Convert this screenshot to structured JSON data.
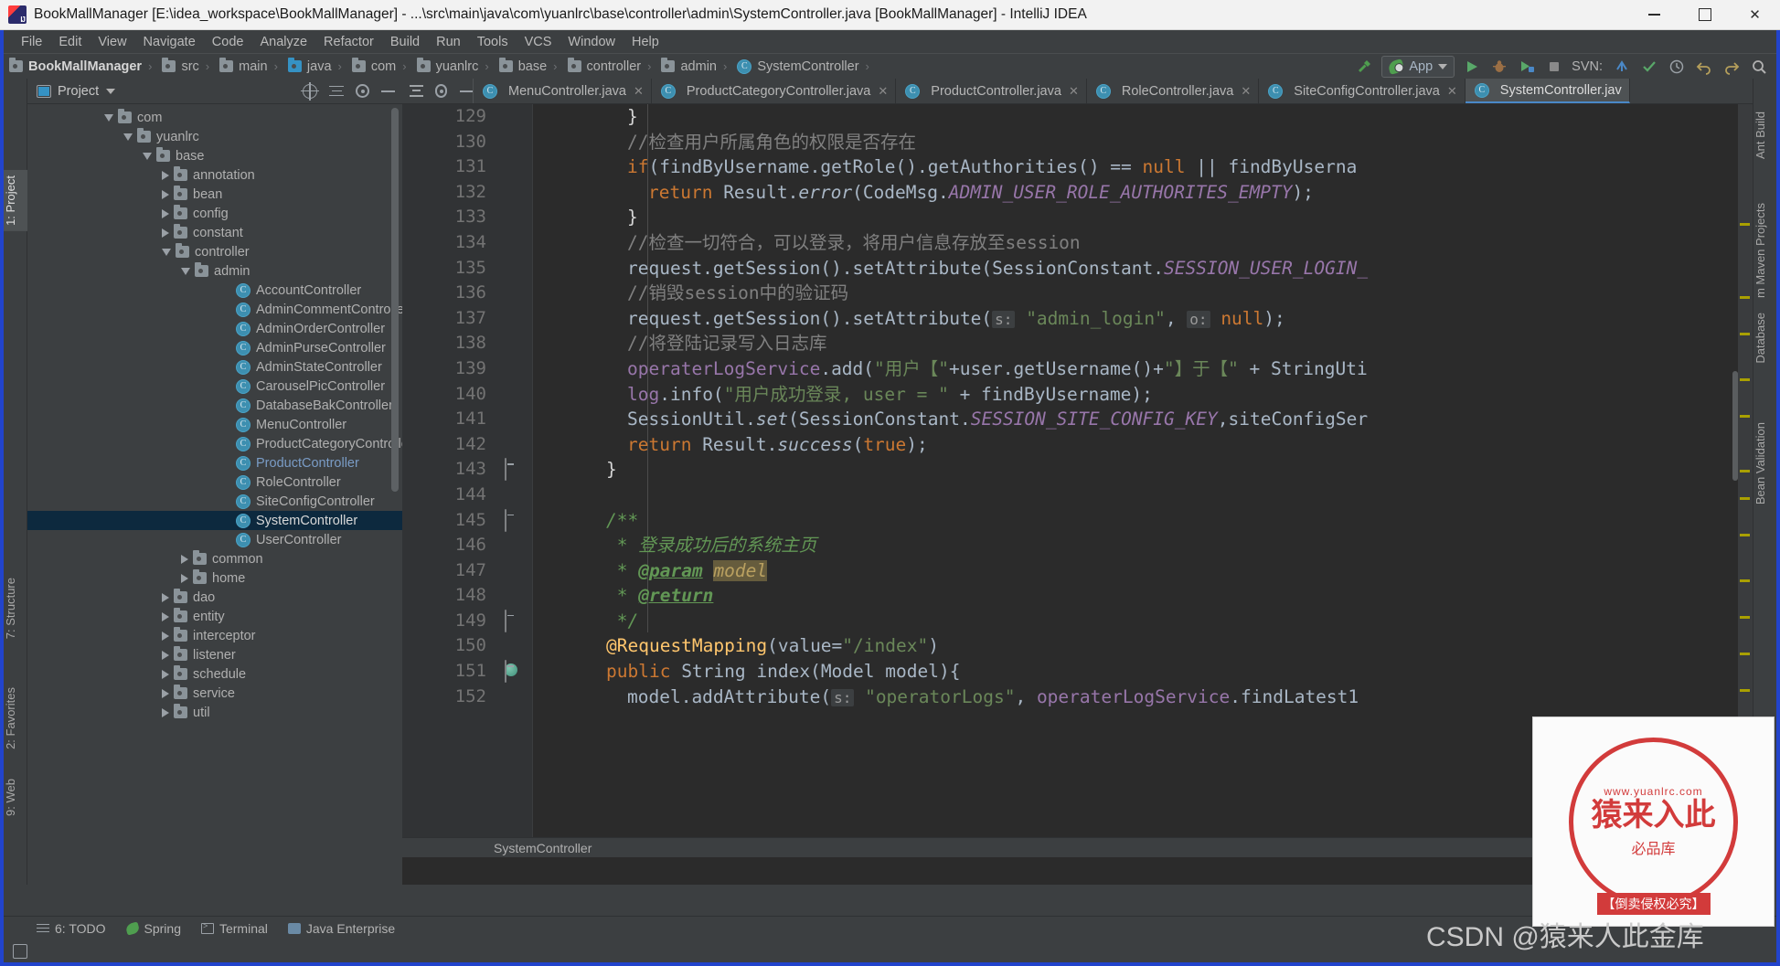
{
  "window": {
    "title": "BookMallManager [E:\\idea_workspace\\BookMallManager] - ...\\src\\main\\java\\com\\yuanlrc\\base\\controller\\admin\\SystemController.java [BookMallManager] - IntelliJ IDEA",
    "minimize_label": "",
    "maximize_label": "",
    "close_label": "✕",
    "app_icon": "intellij-idea-icon"
  },
  "menubar": {
    "items": [
      "File",
      "Edit",
      "View",
      "Navigate",
      "Code",
      "Analyze",
      "Refactor",
      "Build",
      "Run",
      "Tools",
      "VCS",
      "Window",
      "Help"
    ]
  },
  "breadcrumb": {
    "items": [
      {
        "label": "BookMallManager",
        "icon": "folder-icon",
        "kind": "project"
      },
      {
        "label": "src",
        "icon": "folder-icon",
        "kind": "folder"
      },
      {
        "label": "main",
        "icon": "folder-icon",
        "kind": "folder"
      },
      {
        "label": "java",
        "icon": "folder-icon",
        "kind": "source-folder"
      },
      {
        "label": "com",
        "icon": "folder-icon",
        "kind": "package"
      },
      {
        "label": "yuanlrc",
        "icon": "folder-icon",
        "kind": "package"
      },
      {
        "label": "base",
        "icon": "folder-icon",
        "kind": "package"
      },
      {
        "label": "controller",
        "icon": "folder-icon",
        "kind": "package"
      },
      {
        "label": "admin",
        "icon": "folder-icon",
        "kind": "package"
      },
      {
        "label": "SystemController",
        "icon": "class-icon",
        "kind": "class"
      }
    ],
    "separator": "›"
  },
  "toolbar": {
    "build_icon": "hammer-icon",
    "run_config": "App",
    "run_icon": "run-icon",
    "debug_icon": "debug-icon",
    "coverage_icon": "run-coverage-icon",
    "stop_icon": "stop-icon",
    "svn_label": "SVN:",
    "svn_update_icon": "svn-update-icon",
    "svn_commit_icon": "svn-commit-icon",
    "svn_history_icon": "svn-history-icon",
    "undo_icon": "undo-icon",
    "redo_icon": "redo-icon",
    "search_icon": "search-icon"
  },
  "left_strip": {
    "tabs": [
      {
        "label": "1: Project",
        "selected": true
      },
      {
        "label": "7: Structure",
        "selected": false
      },
      {
        "label": "2: Favorites",
        "selected": false
      },
      {
        "label": "9: Web",
        "selected": false
      }
    ]
  },
  "right_strip": {
    "tabs": [
      {
        "label": "Ant Build"
      },
      {
        "label": "m Maven Projects"
      },
      {
        "label": "Database"
      },
      {
        "label": "Bean Validation"
      }
    ]
  },
  "project_panel": {
    "title": "Project",
    "title_caret": "chevron-down-icon",
    "tools": [
      "locate-icon",
      "collapse-all-icon",
      "settings-gear-icon",
      "hide-icon"
    ],
    "tree": [
      {
        "label": "com",
        "indent": 4,
        "state": "open",
        "icon": "folder-icon",
        "selected": false
      },
      {
        "label": "yuanlrc",
        "indent": 5,
        "state": "open",
        "icon": "folder-icon",
        "selected": false
      },
      {
        "label": "base",
        "indent": 6,
        "state": "open",
        "icon": "folder-icon",
        "selected": false
      },
      {
        "label": "annotation",
        "indent": 7,
        "state": "closed",
        "icon": "folder-icon",
        "selected": false
      },
      {
        "label": "bean",
        "indent": 7,
        "state": "closed",
        "icon": "folder-icon",
        "selected": false
      },
      {
        "label": "config",
        "indent": 7,
        "state": "closed",
        "icon": "folder-icon",
        "selected": false
      },
      {
        "label": "constant",
        "indent": 7,
        "state": "closed",
        "icon": "folder-icon",
        "selected": false
      },
      {
        "label": "controller",
        "indent": 7,
        "state": "open",
        "icon": "folder-icon",
        "selected": false
      },
      {
        "label": "admin",
        "indent": 8,
        "state": "open",
        "icon": "folder-icon",
        "selected": false
      },
      {
        "label": "AccountController",
        "indent": 10,
        "state": "leaf",
        "icon": "class-icon",
        "selected": false
      },
      {
        "label": "AdminCommentController",
        "indent": 10,
        "state": "leaf",
        "icon": "class-icon",
        "selected": false
      },
      {
        "label": "AdminOrderController",
        "indent": 10,
        "state": "leaf",
        "icon": "class-icon",
        "selected": false
      },
      {
        "label": "AdminPurseController",
        "indent": 10,
        "state": "leaf",
        "icon": "class-icon",
        "selected": false
      },
      {
        "label": "AdminStateController",
        "indent": 10,
        "state": "leaf",
        "icon": "class-icon",
        "selected": false
      },
      {
        "label": "CarouselPicController",
        "indent": 10,
        "state": "leaf",
        "icon": "class-icon",
        "selected": false
      },
      {
        "label": "DatabaseBakController",
        "indent": 10,
        "state": "leaf",
        "icon": "class-icon",
        "selected": false
      },
      {
        "label": "MenuController",
        "indent": 10,
        "state": "leaf",
        "icon": "class-icon",
        "selected": false
      },
      {
        "label": "ProductCategoryController",
        "indent": 10,
        "state": "leaf",
        "icon": "class-icon",
        "selected": false
      },
      {
        "label": "ProductController",
        "indent": 10,
        "state": "leaf",
        "icon": "class-icon",
        "selected": false,
        "highlight": true
      },
      {
        "label": "RoleController",
        "indent": 10,
        "state": "leaf",
        "icon": "class-icon",
        "selected": false
      },
      {
        "label": "SiteConfigController",
        "indent": 10,
        "state": "leaf",
        "icon": "class-icon",
        "selected": false
      },
      {
        "label": "SystemController",
        "indent": 10,
        "state": "leaf",
        "icon": "class-icon",
        "selected": true
      },
      {
        "label": "UserController",
        "indent": 10,
        "state": "leaf",
        "icon": "class-icon",
        "selected": false
      },
      {
        "label": "common",
        "indent": 8,
        "state": "closed",
        "icon": "folder-icon",
        "selected": false
      },
      {
        "label": "home",
        "indent": 8,
        "state": "closed",
        "icon": "folder-icon",
        "selected": false
      },
      {
        "label": "dao",
        "indent": 7,
        "state": "closed",
        "icon": "folder-icon",
        "selected": false
      },
      {
        "label": "entity",
        "indent": 7,
        "state": "closed",
        "icon": "folder-icon",
        "selected": false
      },
      {
        "label": "interceptor",
        "indent": 7,
        "state": "closed",
        "icon": "folder-icon",
        "selected": false
      },
      {
        "label": "listener",
        "indent": 7,
        "state": "closed",
        "icon": "folder-icon",
        "selected": false
      },
      {
        "label": "schedule",
        "indent": 7,
        "state": "closed",
        "icon": "folder-icon",
        "selected": false
      },
      {
        "label": "service",
        "indent": 7,
        "state": "closed",
        "icon": "folder-icon",
        "selected": false
      },
      {
        "label": "util",
        "indent": 7,
        "state": "closed",
        "icon": "folder-icon",
        "selected": false
      }
    ]
  },
  "editor": {
    "tabs": [
      {
        "label": "MenuController.java",
        "active": false,
        "close": "✕"
      },
      {
        "label": "ProductCategoryController.java",
        "active": false,
        "close": "✕"
      },
      {
        "label": "ProductController.java",
        "active": false,
        "close": "✕"
      },
      {
        "label": "RoleController.java",
        "active": false,
        "close": "✕"
      },
      {
        "label": "SiteConfigController.java",
        "active": false,
        "close": "✕"
      },
      {
        "label": "SystemController.jav",
        "active": true,
        "close": ""
      }
    ],
    "status_breadcrumb": "SystemController",
    "first_line_number": 129,
    "lines": [
      {
        "n": 129,
        "indent": 2,
        "tokens": [
          {
            "t": "}",
            "c": "white"
          }
        ]
      },
      {
        "n": 130,
        "indent": 2,
        "tokens": [
          {
            "t": "//检查用户所属角色的权限是否存在",
            "c": "cmt"
          }
        ]
      },
      {
        "n": 131,
        "indent": 2,
        "tokens": [
          {
            "t": "if",
            "c": "kw"
          },
          {
            "t": "(findByUsername.getRole().getAuthorities() == ",
            "c": "plain"
          },
          {
            "t": "null",
            "c": "kw"
          },
          {
            "t": " || findByUserna",
            "c": "plain"
          }
        ]
      },
      {
        "n": 132,
        "indent": 3,
        "tokens": [
          {
            "t": "return",
            "c": "kw"
          },
          {
            "t": " Result.",
            "c": "plain"
          },
          {
            "t": "error",
            "c": "ital"
          },
          {
            "t": "(CodeMsg.",
            "c": "plain"
          },
          {
            "t": "ADMIN_USER_ROLE_AUTHORITES_EMPTY",
            "c": "cst"
          },
          {
            "t": ");",
            "c": "plain"
          }
        ]
      },
      {
        "n": 133,
        "indent": 2,
        "tokens": [
          {
            "t": "}",
            "c": "white"
          }
        ]
      },
      {
        "n": 134,
        "indent": 2,
        "tokens": [
          {
            "t": "//检查一切符合，可以登录，将用户信息存放至session",
            "c": "cmt"
          }
        ]
      },
      {
        "n": 135,
        "indent": 2,
        "tokens": [
          {
            "t": "request.getSession().setAttribute(SessionConstant.",
            "c": "plain"
          },
          {
            "t": "SESSION_USER_LOGIN_",
            "c": "cst"
          }
        ]
      },
      {
        "n": 136,
        "indent": 2,
        "tokens": [
          {
            "t": "//销毁session中的验证码",
            "c": "cmt"
          }
        ]
      },
      {
        "n": 137,
        "indent": 2,
        "tokens": [
          {
            "t": "request.getSession().setAttribute(",
            "c": "plain"
          },
          {
            "t": "s:",
            "c": "hint"
          },
          {
            "t": " ",
            "c": "plain"
          },
          {
            "t": "\"admin_login\"",
            "c": "str"
          },
          {
            "t": ", ",
            "c": "plain"
          },
          {
            "t": "o:",
            "c": "hint"
          },
          {
            "t": " ",
            "c": "plain"
          },
          {
            "t": "null",
            "c": "kw"
          },
          {
            "t": ");",
            "c": "plain"
          }
        ]
      },
      {
        "n": 138,
        "indent": 2,
        "tokens": [
          {
            "t": "//将登陆记录写入日志库",
            "c": "cmt"
          }
        ]
      },
      {
        "n": 139,
        "indent": 2,
        "tokens": [
          {
            "t": "operaterLogService",
            "c": "fld"
          },
          {
            "t": ".add(",
            "c": "plain"
          },
          {
            "t": "\"用户【\"",
            "c": "str"
          },
          {
            "t": "+user.getUsername()+",
            "c": "plain"
          },
          {
            "t": "\"】于【\"",
            "c": "str"
          },
          {
            "t": " + StringUti",
            "c": "plain"
          }
        ]
      },
      {
        "n": 140,
        "indent": 2,
        "tokens": [
          {
            "t": "log",
            "c": "fld"
          },
          {
            "t": ".info(",
            "c": "plain"
          },
          {
            "t": "\"用户成功登录, user = \"",
            "c": "str"
          },
          {
            "t": " + findByUsername);",
            "c": "plain"
          }
        ]
      },
      {
        "n": 141,
        "indent": 2,
        "tokens": [
          {
            "t": "SessionUtil.",
            "c": "plain"
          },
          {
            "t": "set",
            "c": "ital"
          },
          {
            "t": "(SessionConstant.",
            "c": "plain"
          },
          {
            "t": "SESSION_SITE_CONFIG_KEY",
            "c": "cst"
          },
          {
            "t": ",siteConfigSer",
            "c": "plain"
          }
        ]
      },
      {
        "n": 142,
        "indent": 2,
        "tokens": [
          {
            "t": "return",
            "c": "kw"
          },
          {
            "t": " Result.",
            "c": "plain"
          },
          {
            "t": "success",
            "c": "ital"
          },
          {
            "t": "(",
            "c": "plain"
          },
          {
            "t": "true",
            "c": "kw"
          },
          {
            "t": ");",
            "c": "plain"
          }
        ]
      },
      {
        "n": 143,
        "indent": 1,
        "fold": "end",
        "tokens": [
          {
            "t": "}",
            "c": "white"
          }
        ]
      },
      {
        "n": 144,
        "indent": 0,
        "tokens": []
      },
      {
        "n": 145,
        "indent": 1,
        "fold": "start",
        "tokens": [
          {
            "t": "/**",
            "c": "jdoc"
          }
        ]
      },
      {
        "n": 146,
        "indent": 1,
        "tokens": [
          {
            "t": " * 登录成功后的系统主页",
            "c": "jdoc"
          }
        ]
      },
      {
        "n": 147,
        "indent": 1,
        "tokens": [
          {
            "t": " * ",
            "c": "jdoc"
          },
          {
            "t": "@param",
            "c": "jtag"
          },
          {
            "t": " ",
            "c": "jdoc"
          },
          {
            "t": "model",
            "c": "hl-param"
          }
        ]
      },
      {
        "n": 148,
        "indent": 1,
        "tokens": [
          {
            "t": " * ",
            "c": "jdoc"
          },
          {
            "t": "@return",
            "c": "jtag"
          }
        ]
      },
      {
        "n": 149,
        "indent": 1,
        "fold": "end",
        "tokens": [
          {
            "t": " */",
            "c": "jdoc"
          }
        ]
      },
      {
        "n": 150,
        "indent": 1,
        "tokens": [
          {
            "t": "@RequestMapping",
            "c": "mth"
          },
          {
            "t": "(value=",
            "c": "plain"
          },
          {
            "t": "\"/index\"",
            "c": "str"
          },
          {
            "t": ")",
            "c": "plain"
          }
        ]
      },
      {
        "n": 151,
        "indent": 1,
        "fold": "start",
        "gutter_icon": "spring-bean-icon",
        "tokens": [
          {
            "t": "public",
            "c": "kw"
          },
          {
            "t": " String index(Model model){",
            "c": "plain"
          }
        ]
      },
      {
        "n": 152,
        "indent": 2,
        "tokens": [
          {
            "t": "model.addAttribute(",
            "c": "plain"
          },
          {
            "t": "s:",
            "c": "hint"
          },
          {
            "t": " ",
            "c": "plain"
          },
          {
            "t": "\"operatorLogs\"",
            "c": "str"
          },
          {
            "t": ", ",
            "c": "plain"
          },
          {
            "t": "operaterLogService",
            "c": "fld"
          },
          {
            "t": ".findLatest1",
            "c": "plain"
          }
        ]
      }
    ]
  },
  "bottom_bar": {
    "items": [
      {
        "label": "6: TODO",
        "icon": "todo-icon"
      },
      {
        "label": "Spring",
        "icon": "spring-leaf-icon"
      },
      {
        "label": "Terminal",
        "icon": "terminal-icon"
      },
      {
        "label": "Java Enterprise",
        "icon": "java-enterprise-icon"
      }
    ]
  },
  "watermark": {
    "site": "www.yuanlrc.com",
    "seal_text": "猿来入此",
    "seal_sub": "必品库",
    "seal_banner": "【倒卖侵权必究】",
    "csdn": "CSDN @猿来人此金库"
  },
  "colors": {
    "titlebar_bg": "#f2f2f2",
    "chrome_bg": "#3c3f41",
    "editor_bg": "#2b2b2b",
    "accent_blue": "#3592c4",
    "selection": "#0d293e",
    "keyword": "#cc7832",
    "string": "#6a8759",
    "comment": "#808080",
    "javadoc": "#629755",
    "constant": "#9876aa",
    "frame": "#2244cc"
  }
}
